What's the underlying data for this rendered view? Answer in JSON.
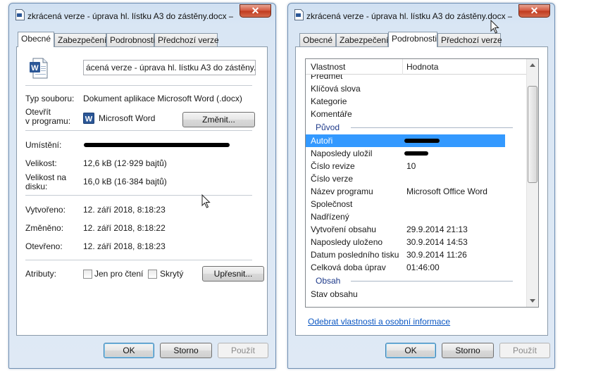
{
  "left_window": {
    "title": "zkrácená verze - úprava hl. lístku A3 do zástěny.docx –",
    "close": "✕",
    "tabs": [
      "Obecné",
      "Zabezpečení",
      "Podrobnosti",
      "Předchozí verze"
    ],
    "active_tab": 0,
    "filename": "ácená verze - úprava hl. lístku A3 do zástěny.docx",
    "file_type_label": "Typ souboru:",
    "file_type_value": "Dokument aplikace Microsoft Word (.docx)",
    "opens_with_label_1": "Otevřít",
    "opens_with_label_2": "v programu:",
    "opens_with_value": "Microsoft Word",
    "change_button": "Změnit...",
    "location_label": "Umístění:",
    "size_label": "Velikost:",
    "size_value": "12,6 kB (12·929 bajtů)",
    "size_on_disk_label_1": "Velikost na",
    "size_on_disk_label_2": "disku:",
    "size_on_disk_value": "16,0 kB (16·384 bajtů)",
    "created_label": "Vytvořeno:",
    "created_value": "12. září 2018, 8:18:23",
    "modified_label": "Změněno:",
    "modified_value": "12. září 2018, 8:18:22",
    "accessed_label": "Otevřeno:",
    "accessed_value": "12. září 2018, 8:18:23",
    "attributes_label": "Atributy:",
    "readonly_label": "Jen pro čtení",
    "hidden_label": "Skrytý",
    "advanced_button": "Upřesnit...",
    "ok": "OK",
    "cancel": "Storno",
    "apply": "Použít"
  },
  "right_window": {
    "title": "zkrácená verze - úprava hl. lístku A3 do zástěny.docx –",
    "close": "✕",
    "tabs": [
      "Obecné",
      "Zabezpečení",
      "Podrobnosti",
      "Předchozí verze"
    ],
    "active_tab": 2,
    "col_property": "Vlastnost",
    "col_value": "Hodnota",
    "rows": [
      {
        "name": "Předmět",
        "value": ""
      },
      {
        "name": "Klíčová slova",
        "value": ""
      },
      {
        "name": "Kategorie",
        "value": ""
      },
      {
        "name": "Komentáře",
        "value": ""
      },
      {
        "group": "Původ"
      },
      {
        "name": "Autoři",
        "value": "",
        "selected": true,
        "redacted": true
      },
      {
        "name": "Naposledy uložil",
        "value": "",
        "redacted": true
      },
      {
        "name": "Číslo revize",
        "value": "10"
      },
      {
        "name": "Číslo verze",
        "value": ""
      },
      {
        "name": "Název programu",
        "value": "Microsoft Office Word"
      },
      {
        "name": "Společnost",
        "value": ""
      },
      {
        "name": "Nadřízený",
        "value": ""
      },
      {
        "name": "Vytvoření obsahu",
        "value": "29.9.2014 21:13"
      },
      {
        "name": "Naposledy uloženo",
        "value": "30.9.2014 14:53"
      },
      {
        "name": "Datum posledního tisku",
        "value": "30.9.2014 11:26"
      },
      {
        "name": "Celková doba úprav",
        "value": "01:46:00"
      },
      {
        "group": "Obsah"
      },
      {
        "name": "Stav obsahu",
        "value": ""
      }
    ],
    "remove_link": "Odebrat vlastnosti a osobní informace",
    "ok": "OK",
    "cancel": "Storno",
    "apply": "Použít"
  },
  "colors": {
    "selection": "#3399ff",
    "group_text": "#1e3a8a",
    "link": "#0a56c2",
    "close_button": "#c0391d"
  },
  "icons": [
    "document-icon",
    "word-file-icon",
    "word-app-icon",
    "close-icon",
    "mouse-cursor-icon",
    "scroll-up-icon",
    "scroll-down-icon"
  ]
}
